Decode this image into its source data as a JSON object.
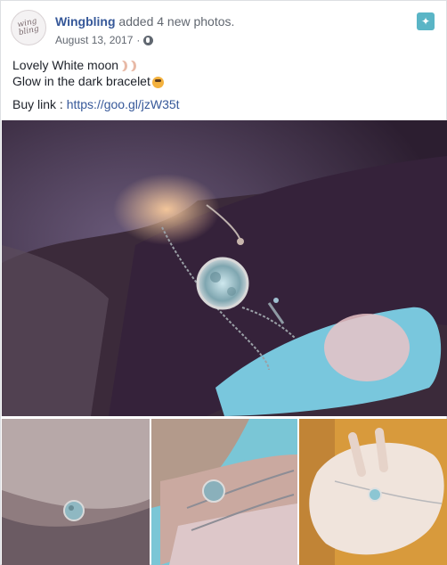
{
  "post": {
    "author": "Wingbling",
    "action": " added 4 new photos.",
    "date": "August 13, 2017",
    "separator": "·",
    "privacy_icon": "globe-icon",
    "menu_icon": "pin-icon",
    "avatar_text_line1": "wing",
    "avatar_text_line2": "bling",
    "text": {
      "line1": "Lovely White moon",
      "line2": "Glow in the dark bracelet",
      "buy_label": "Buy link : ",
      "buy_url": "https://goo.gl/jzW35t"
    }
  },
  "colors": {
    "link": "#365899",
    "accent_pin": "#5ab5c6",
    "meta_text": "#616770"
  }
}
